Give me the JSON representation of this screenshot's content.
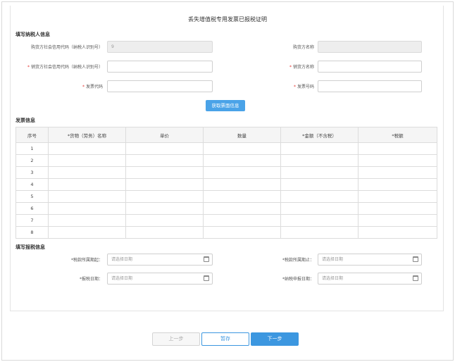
{
  "page": {
    "title": "丢失增值税专用发票已报税证明"
  },
  "taxpayer_section": {
    "title": "填写纳税人信息",
    "buyer_code_label": "购货方社会信用代码（纳税人识别号）",
    "buyer_code_value": "9",
    "buyer_name_label": "购货方名称",
    "buyer_name_value": "",
    "seller_code_label": "销货方社会信用代码（纳税人识别号）",
    "seller_code_value": "",
    "seller_name_label": "销货方名称",
    "seller_name_value": "",
    "invoice_code_label": "发票代码",
    "invoice_code_value": "",
    "invoice_number_label": "发票号码",
    "invoice_number_value": "",
    "fetch_button": "获取票面信息"
  },
  "invoice_section": {
    "title": "发票信息",
    "columns": [
      "序号",
      "*货物（劳务）名称",
      "单价",
      "数量",
      "*金额（不含税）",
      "*税额"
    ],
    "rows": [
      [
        "1",
        "",
        "",
        "",
        "",
        ""
      ],
      [
        "2",
        "",
        "",
        "",
        "",
        ""
      ],
      [
        "3",
        "",
        "",
        "",
        "",
        ""
      ],
      [
        "4",
        "",
        "",
        "",
        "",
        ""
      ],
      [
        "5",
        "",
        "",
        "",
        "",
        ""
      ],
      [
        "6",
        "",
        "",
        "",
        "",
        ""
      ],
      [
        "7",
        "",
        "",
        "",
        "",
        ""
      ],
      [
        "8",
        "",
        "",
        "",
        "",
        ""
      ]
    ]
  },
  "declaration_section": {
    "title": "填写报税信息",
    "period_start_label": "*税款所属期起：",
    "period_start_placeholder": "请选择日期",
    "period_end_label": "*税款所属期止：",
    "period_end_placeholder": "请选择日期",
    "tax_date_label": "*报税日期：",
    "tax_date_placeholder": "请选择日期",
    "filing_date_label": "*纳税申报日期：",
    "filing_date_placeholder": "请选择日期"
  },
  "footer": {
    "prev_button": "上一步",
    "save_button": "暂存",
    "next_button": "下一步"
  },
  "colors": {
    "accent": "#3c97e0",
    "required": "#e53935"
  }
}
